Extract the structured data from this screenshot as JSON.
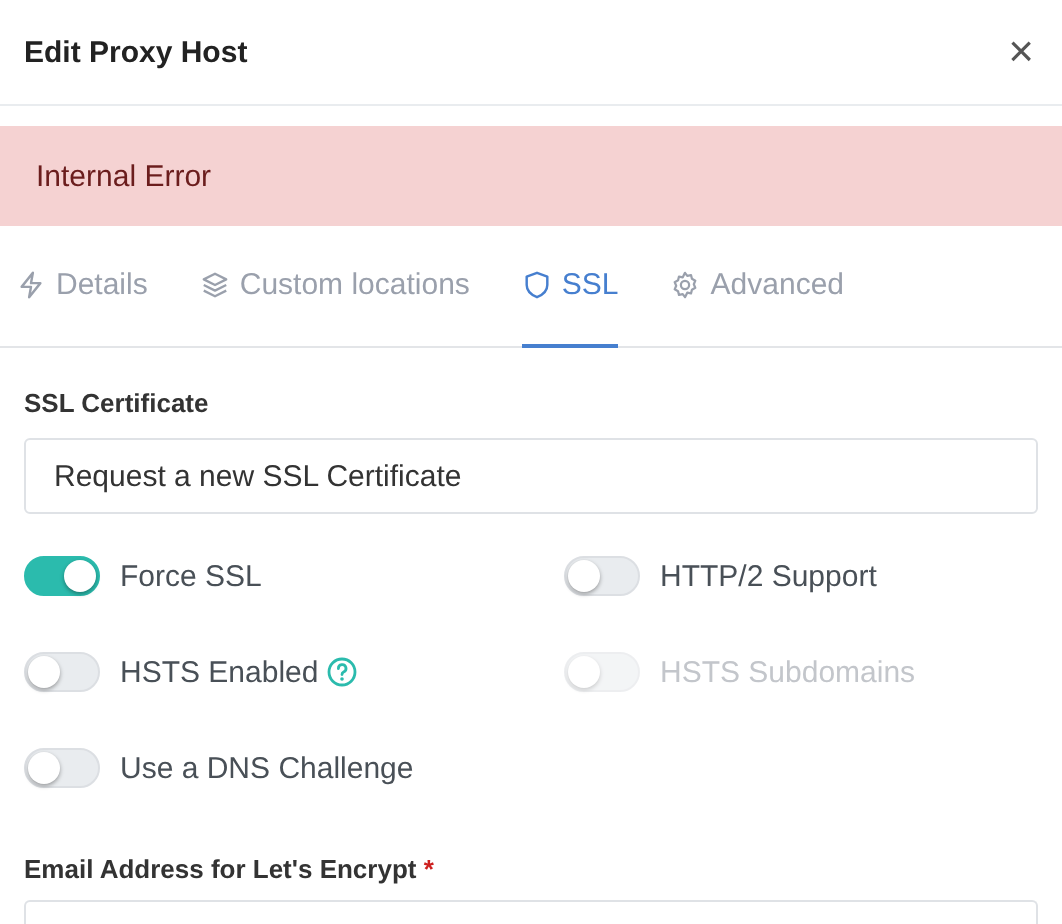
{
  "window": {
    "title": "Edit Proxy Host",
    "close": "×"
  },
  "alert": {
    "text": "Internal Error"
  },
  "tabs": [
    {
      "label": "Details",
      "kind": "bolt",
      "selected": false
    },
    {
      "label": "Custom locations",
      "kind": "layers",
      "selected": false
    },
    {
      "label": "SSL",
      "kind": "shield",
      "selected": true
    },
    {
      "label": "Advanced",
      "kind": "gear",
      "selected": false
    }
  ],
  "certificate": {
    "label": "SSL Certificate",
    "value": "Request a new SSL Certificate"
  },
  "switches": [
    {
      "label": "Force SSL",
      "on": true,
      "disabled": false,
      "help": false
    },
    {
      "label": "HTTP/2 Support",
      "on": false,
      "disabled": false,
      "help": false
    },
    {
      "label": "HSTS Enabled",
      "on": false,
      "disabled": false,
      "help": true
    },
    {
      "label": "HSTS Subdomains",
      "on": false,
      "disabled": true,
      "help": false
    },
    {
      "label": "Use a DNS Challenge",
      "on": false,
      "disabled": false,
      "help": false
    }
  ],
  "email": {
    "label": "Email Address for Let's Encrypt",
    "required": "*"
  }
}
